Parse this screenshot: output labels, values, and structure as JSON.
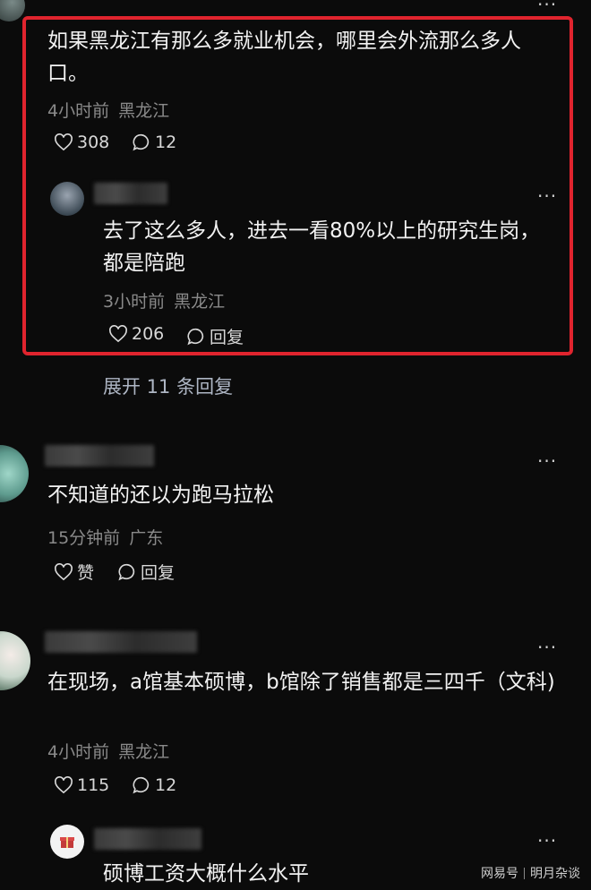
{
  "comments": [
    {
      "text": "如果黑龙江有那么多就业机会，哪里会外流那么多人口。",
      "time": "4小时前",
      "location": "黑龙江",
      "likes": "308",
      "replies": "12",
      "reply": {
        "text": "去了这么多人，进去一看80%以上的研究生岗，都是陪跑",
        "time": "3小时前",
        "location": "黑龙江",
        "likes": "206",
        "reply_label": "回复"
      },
      "expand_label": "展开 11 条回复"
    },
    {
      "text": "不知道的还以为跑马拉松",
      "time": "15分钟前",
      "location": "广东",
      "likes": "赞",
      "replies": "回复"
    },
    {
      "text": "在现场，a馆基本硕博，b馆除了销售都是三四千（文科)",
      "time": "4小时前",
      "location": "黑龙江",
      "likes": "115",
      "replies": "12",
      "reply": {
        "text": "硕博工资大概什么水平"
      }
    }
  ],
  "watermark": {
    "brand": "网易号",
    "author": "明月杂谈"
  },
  "colors": {
    "highlight": "#e0242e",
    "background": "#0b0b0b"
  }
}
